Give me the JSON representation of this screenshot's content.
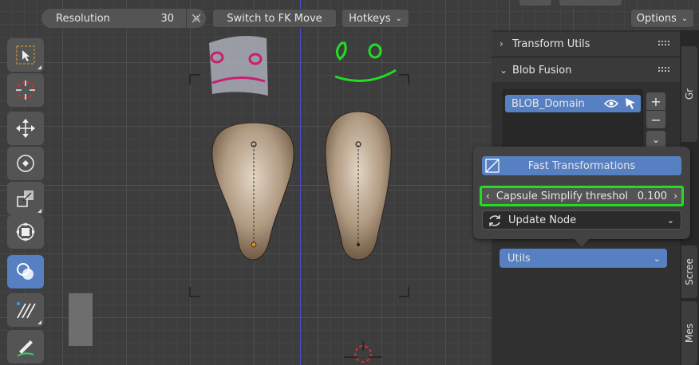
{
  "header": {
    "resolution_label": "Resolution",
    "resolution_value": "30",
    "fk_button": "Switch to FK Move",
    "hotkeys_label": "Hotkeys",
    "options_label": "Options"
  },
  "toolbar": {
    "tools": [
      "select-box",
      "cursor",
      "move",
      "rotate",
      "scale",
      "transform",
      "blob",
      "annotate-lines",
      "draw"
    ],
    "active_tool": "blob"
  },
  "panel": {
    "transform_utils": "Transform Utils",
    "blob_fusion": "Blob Fusion",
    "list_item": "BLOB_Domain",
    "add_symbol": "+",
    "remove_symbol": "−",
    "utils_label": "Utils"
  },
  "popup": {
    "fast_transformations": "Fast Transformations",
    "capsule_label": "Capsule Simplify threshol",
    "capsule_value": "0.100",
    "update_node": "Update Node"
  },
  "side_tabs": [
    "Gr",
    "Scree",
    "Mes"
  ],
  "colors": {
    "accent": "#5680c2",
    "highlight": "#22dd22",
    "annotation_green": "#22dd22",
    "annotation_magenta": "#c8206e"
  }
}
